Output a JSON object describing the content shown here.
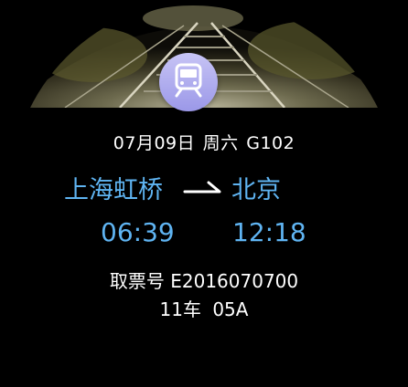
{
  "ticket": {
    "date": "07月09日",
    "weekday": "周六",
    "train_no": "G102",
    "from_station": "上海虹桥",
    "to_station": "北京",
    "depart_time": "06:39",
    "arrive_time": "12:18",
    "pickup_label": "取票号",
    "pickup_code": "E2016070700",
    "car": "11车",
    "seat": "05A"
  },
  "icons": {
    "train": "train-icon",
    "direction": "arrow-right-icon"
  },
  "colors": {
    "accent": "#5fb4f2",
    "badge": "#b3b0f0",
    "background": "#000000"
  }
}
